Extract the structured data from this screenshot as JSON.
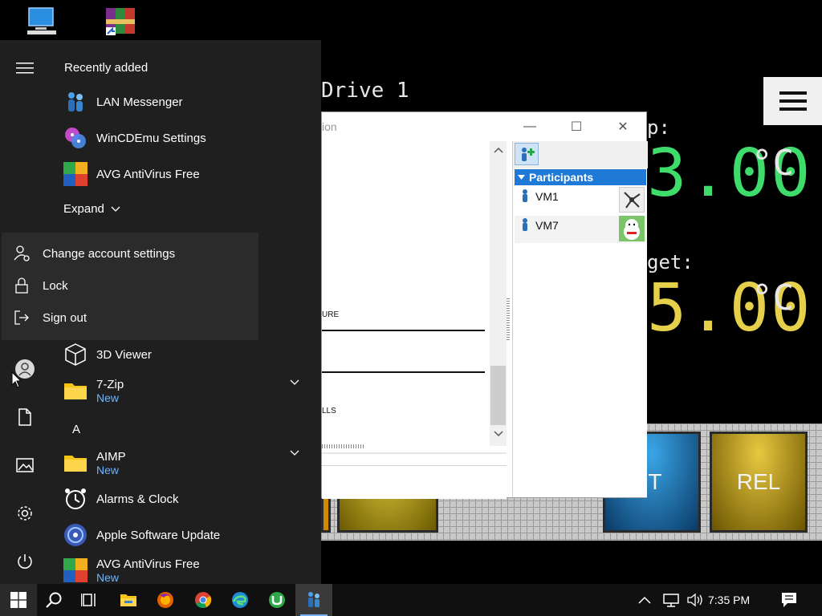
{
  "desktop": {
    "icons": [
      {
        "name": "This PC",
        "icon": "computer-icon"
      },
      {
        "name": "WinRAR",
        "icon": "winrar-icon"
      }
    ]
  },
  "controller": {
    "drive_label": "Drive 1",
    "temp_label_partial": "p:",
    "temp_value_partial": "3.00",
    "target_label_partial": "get:",
    "target_value_partial": "5.00",
    "unit": "°C",
    "buttons": [
      {
        "label": "",
        "color": "#caa000"
      },
      {
        "label": "",
        "color": "#c0a000"
      },
      {
        "label": "IT",
        "color": "#1a72b8"
      },
      {
        "label": "REL",
        "color": "#c9a400"
      }
    ],
    "menu_icon": "hamburger-menu-icon",
    "colors": {
      "temp": "#3ddc6b",
      "target": "#e6d04a"
    }
  },
  "lan_window": {
    "title_partial": "ion",
    "controls": {
      "minimize": "—",
      "maximize": "☐",
      "close": "✕"
    },
    "left_text_1": "URE",
    "left_text_2": "LLS",
    "participants_header": "Participants",
    "participants": [
      {
        "name": "VM1",
        "avatar": "network-avatar-icon"
      },
      {
        "name": "VM7",
        "avatar": "lucky-cat-avatar-icon"
      }
    ]
  },
  "start_menu": {
    "recently_added_title": "Recently added",
    "recent": [
      {
        "label": "LAN Messenger",
        "icon": "lan-messenger-icon"
      },
      {
        "label": "WinCDEmu Settings",
        "icon": "wincdemu-icon"
      },
      {
        "label": "AVG AntiVirus Free",
        "icon": "avg-icon"
      }
    ],
    "expand_label": "Expand",
    "account_menu": [
      {
        "label": "Change account settings",
        "icon": "account-settings-icon"
      },
      {
        "label": "Lock",
        "icon": "lock-icon"
      },
      {
        "label": "Sign out",
        "icon": "sign-out-icon"
      }
    ],
    "apps": [
      {
        "label": "3D Viewer",
        "icon": "cube-icon",
        "new": ""
      },
      {
        "label": "7-Zip",
        "icon": "folder-icon",
        "new": "New"
      },
      {
        "section": "A"
      },
      {
        "label": "AIMP",
        "icon": "folder-icon",
        "new": "New"
      },
      {
        "label": "Alarms & Clock",
        "icon": "alarm-clock-icon",
        "new": ""
      },
      {
        "label": "Apple Software Update",
        "icon": "apple-update-icon",
        "new": ""
      },
      {
        "label": "AVG AntiVirus Free",
        "icon": "avg-icon",
        "new": "New"
      }
    ],
    "rail_icons": [
      "hamburger-icon",
      "user-avatar-icon",
      "documents-icon",
      "pictures-icon",
      "settings-gear-icon",
      "power-icon"
    ]
  },
  "taskbar": {
    "buttons": [
      "start-icon",
      "search-icon",
      "task-view-icon",
      "file-explorer-icon",
      "firefox-icon",
      "chrome-icon",
      "edge-icon",
      "utorrent-icon",
      "lan-messenger-icon"
    ],
    "tray": [
      "show-hidden-icons-icon",
      "network-icon",
      "volume-icon"
    ],
    "time": "7:35 PM",
    "notification_icon": "action-center-icon"
  }
}
